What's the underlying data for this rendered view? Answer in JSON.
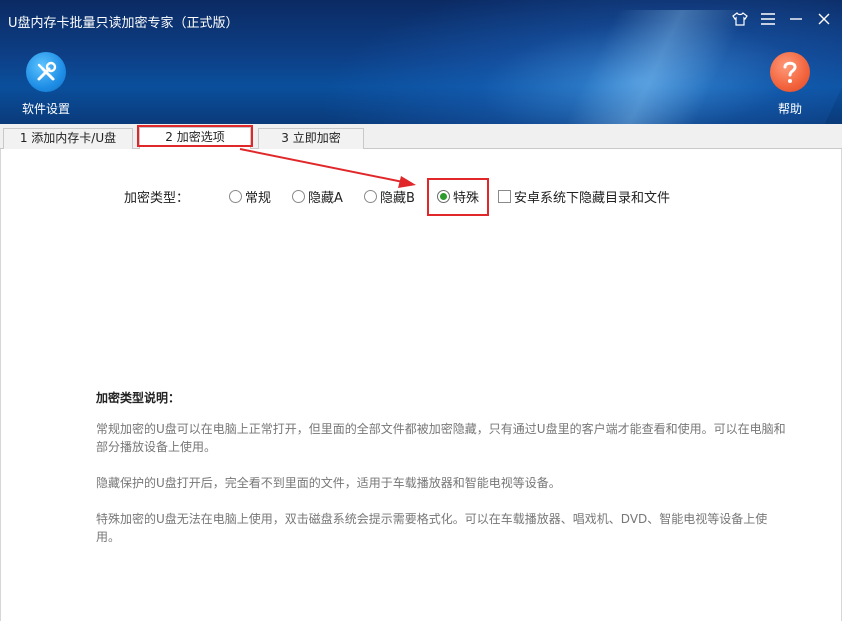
{
  "window": {
    "title": "U盘内存卡批量只读加密专家（正式版）",
    "controls": [
      {
        "name": "skin-icon"
      },
      {
        "name": "menu-icon"
      },
      {
        "name": "minimize-icon"
      },
      {
        "name": "close-icon"
      }
    ]
  },
  "toolbar": {
    "settings_label": "软件设置",
    "help_label": "帮助"
  },
  "tabs": [
    {
      "label": "1 添加内存卡/U盘"
    },
    {
      "label": "2 加密选项"
    },
    {
      "label": "3 立即加密"
    }
  ],
  "active_tab": "2 加密选项",
  "encryption": {
    "type_label": "加密类型：",
    "options": [
      {
        "label": "常规",
        "checked": false
      },
      {
        "label": "隐藏A",
        "checked": false
      },
      {
        "label": "隐藏B",
        "checked": false
      },
      {
        "label": "特殊",
        "checked": true
      }
    ],
    "android_checkbox": {
      "label": "安卓系统下隐藏目录和文件",
      "checked": false
    }
  },
  "description": {
    "heading": "加密类型说明：",
    "paragraphs": [
      "常规加密的U盘可以在电脑上正常打开，但里面的全部文件都被加密隐藏，只有通过U盘里的客户端才能查看和使用。可以在电脑和部分播放设备上使用。",
      "隐藏保护的U盘打开后，完全看不到里面的文件，适用于车载播放器和智能电视等设备。",
      "特殊加密的U盘无法在电脑上使用，双击磁盘系统会提示需要格式化。可以在车载播放器、唱戏机、DVD、智能电视等设备上使用。"
    ]
  },
  "colors": {
    "header_bg": "#0d3f86",
    "highlight_red": "#e0282b",
    "radio_checked": "#2d9a2d",
    "settings_icon_bg": "#1f8ee6",
    "help_icon_bg": "#f2633c"
  }
}
